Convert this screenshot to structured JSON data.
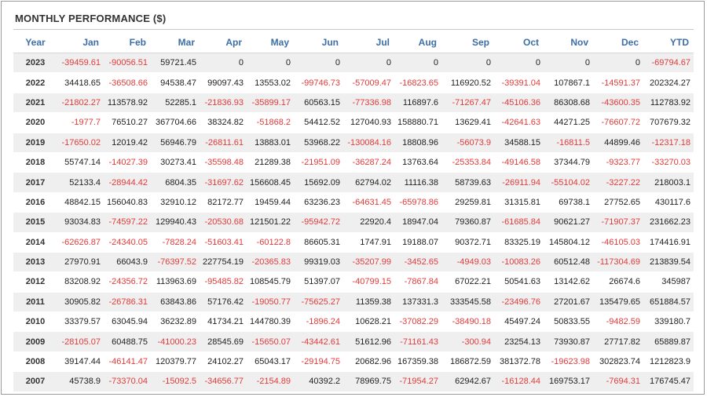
{
  "title": "MONTHLY PERFORMANCE ($)",
  "colors": {
    "header": "#3d6ea6",
    "negative": "#e23b3b",
    "stripe": "#efefef"
  },
  "columns": [
    "Year",
    "Jan",
    "Feb",
    "Mar",
    "Apr",
    "May",
    "Jun",
    "Jul",
    "Aug",
    "Sep",
    "Oct",
    "Nov",
    "Dec",
    "YTD"
  ],
  "rows": [
    [
      "2023",
      "-39459.61",
      "-90056.51",
      "59721.45",
      "0",
      "0",
      "0",
      "0",
      "0",
      "0",
      "0",
      "0",
      "0",
      "-69794.67"
    ],
    [
      "2022",
      "34418.65",
      "-36508.66",
      "94538.47",
      "99097.43",
      "13553.02",
      "-99746.73",
      "-57009.47",
      "-16823.65",
      "116920.52",
      "-39391.04",
      "107867.1",
      "-14591.37",
      "202324.27"
    ],
    [
      "2021",
      "-21802.27",
      "113578.92",
      "52285.1",
      "-21836.93",
      "-35899.17",
      "60563.15",
      "-77336.98",
      "116897.6",
      "-71267.47",
      "-45106.36",
      "86308.68",
      "-43600.35",
      "112783.92"
    ],
    [
      "2020",
      "-1977.7",
      "76510.27",
      "367704.66",
      "38324.82",
      "-51868.2",
      "54412.52",
      "127040.93",
      "158880.71",
      "13629.41",
      "-42641.63",
      "44271.25",
      "-76607.72",
      "707679.32"
    ],
    [
      "2019",
      "-17650.02",
      "12019.42",
      "56946.79",
      "-26811.61",
      "13883.01",
      "53968.22",
      "-130084.16",
      "18808.96",
      "-56073.9",
      "34588.15",
      "-16811.5",
      "44899.46",
      "-12317.18"
    ],
    [
      "2018",
      "55747.14",
      "-14027.39",
      "30273.41",
      "-35598.48",
      "21289.38",
      "-21951.09",
      "-36287.24",
      "13763.64",
      "-25353.84",
      "-49146.58",
      "37344.79",
      "-9323.77",
      "-33270.03"
    ],
    [
      "2017",
      "52133.4",
      "-28944.42",
      "6804.35",
      "-31697.62",
      "156608.45",
      "15692.09",
      "62794.02",
      "11116.38",
      "58739.63",
      "-26911.94",
      "-55104.02",
      "-3227.22",
      "218003.1"
    ],
    [
      "2016",
      "48842.15",
      "156040.83",
      "32910.12",
      "82172.77",
      "19459.44",
      "63236.23",
      "-64631.45",
      "-65978.86",
      "29259.81",
      "31315.81",
      "69738.1",
      "27752.65",
      "430117.6"
    ],
    [
      "2015",
      "93034.83",
      "-74597.22",
      "129940.43",
      "-20530.68",
      "121501.22",
      "-95942.72",
      "22920.4",
      "18947.04",
      "79360.87",
      "-61685.84",
      "90621.27",
      "-71907.37",
      "231662.23"
    ],
    [
      "2014",
      "-62626.87",
      "-24340.05",
      "-7828.24",
      "-51603.41",
      "-60122.8",
      "86605.31",
      "1747.91",
      "19188.07",
      "90372.71",
      "83325.19",
      "145804.12",
      "-46105.03",
      "174416.91"
    ],
    [
      "2013",
      "27970.91",
      "66043.9",
      "-76397.52",
      "227754.19",
      "-20365.83",
      "99319.03",
      "-35207.99",
      "-3452.65",
      "-4949.03",
      "-10083.26",
      "60512.48",
      "-117304.69",
      "213839.54"
    ],
    [
      "2012",
      "83208.92",
      "-24356.72",
      "113963.69",
      "-95485.82",
      "108545.79",
      "51397.07",
      "-40799.15",
      "-7867.84",
      "67022.21",
      "50541.63",
      "13142.62",
      "26674.6",
      "345987"
    ],
    [
      "2011",
      "30905.82",
      "-26786.31",
      "63843.86",
      "57176.42",
      "-19050.77",
      "-75625.27",
      "11359.38",
      "137331.3",
      "333545.58",
      "-23496.76",
      "27201.67",
      "135479.65",
      "651884.57"
    ],
    [
      "2010",
      "33379.57",
      "63045.94",
      "36232.89",
      "41734.21",
      "144780.39",
      "-1896.24",
      "10628.21",
      "-37082.29",
      "-38490.18",
      "45497.24",
      "50833.55",
      "-9482.59",
      "339180.7"
    ],
    [
      "2009",
      "-28105.07",
      "60488.75",
      "-41000.23",
      "28545.69",
      "-15650.07",
      "-43442.61",
      "51612.96",
      "-71161.43",
      "-300.94",
      "23254.13",
      "73930.87",
      "27717.82",
      "65889.87"
    ],
    [
      "2008",
      "39147.44",
      "-46141.47",
      "120379.77",
      "24102.27",
      "65043.17",
      "-29194.75",
      "20682.96",
      "167359.38",
      "186872.59",
      "381372.78",
      "-19623.98",
      "302823.74",
      "1212823.9"
    ],
    [
      "2007",
      "45738.9",
      "-73370.04",
      "-15092.5",
      "-34656.77",
      "-2154.89",
      "40392.2",
      "78969.75",
      "-71954.27",
      "62942.67",
      "-16128.44",
      "169753.17",
      "-7694.31",
      "176745.47"
    ]
  ]
}
